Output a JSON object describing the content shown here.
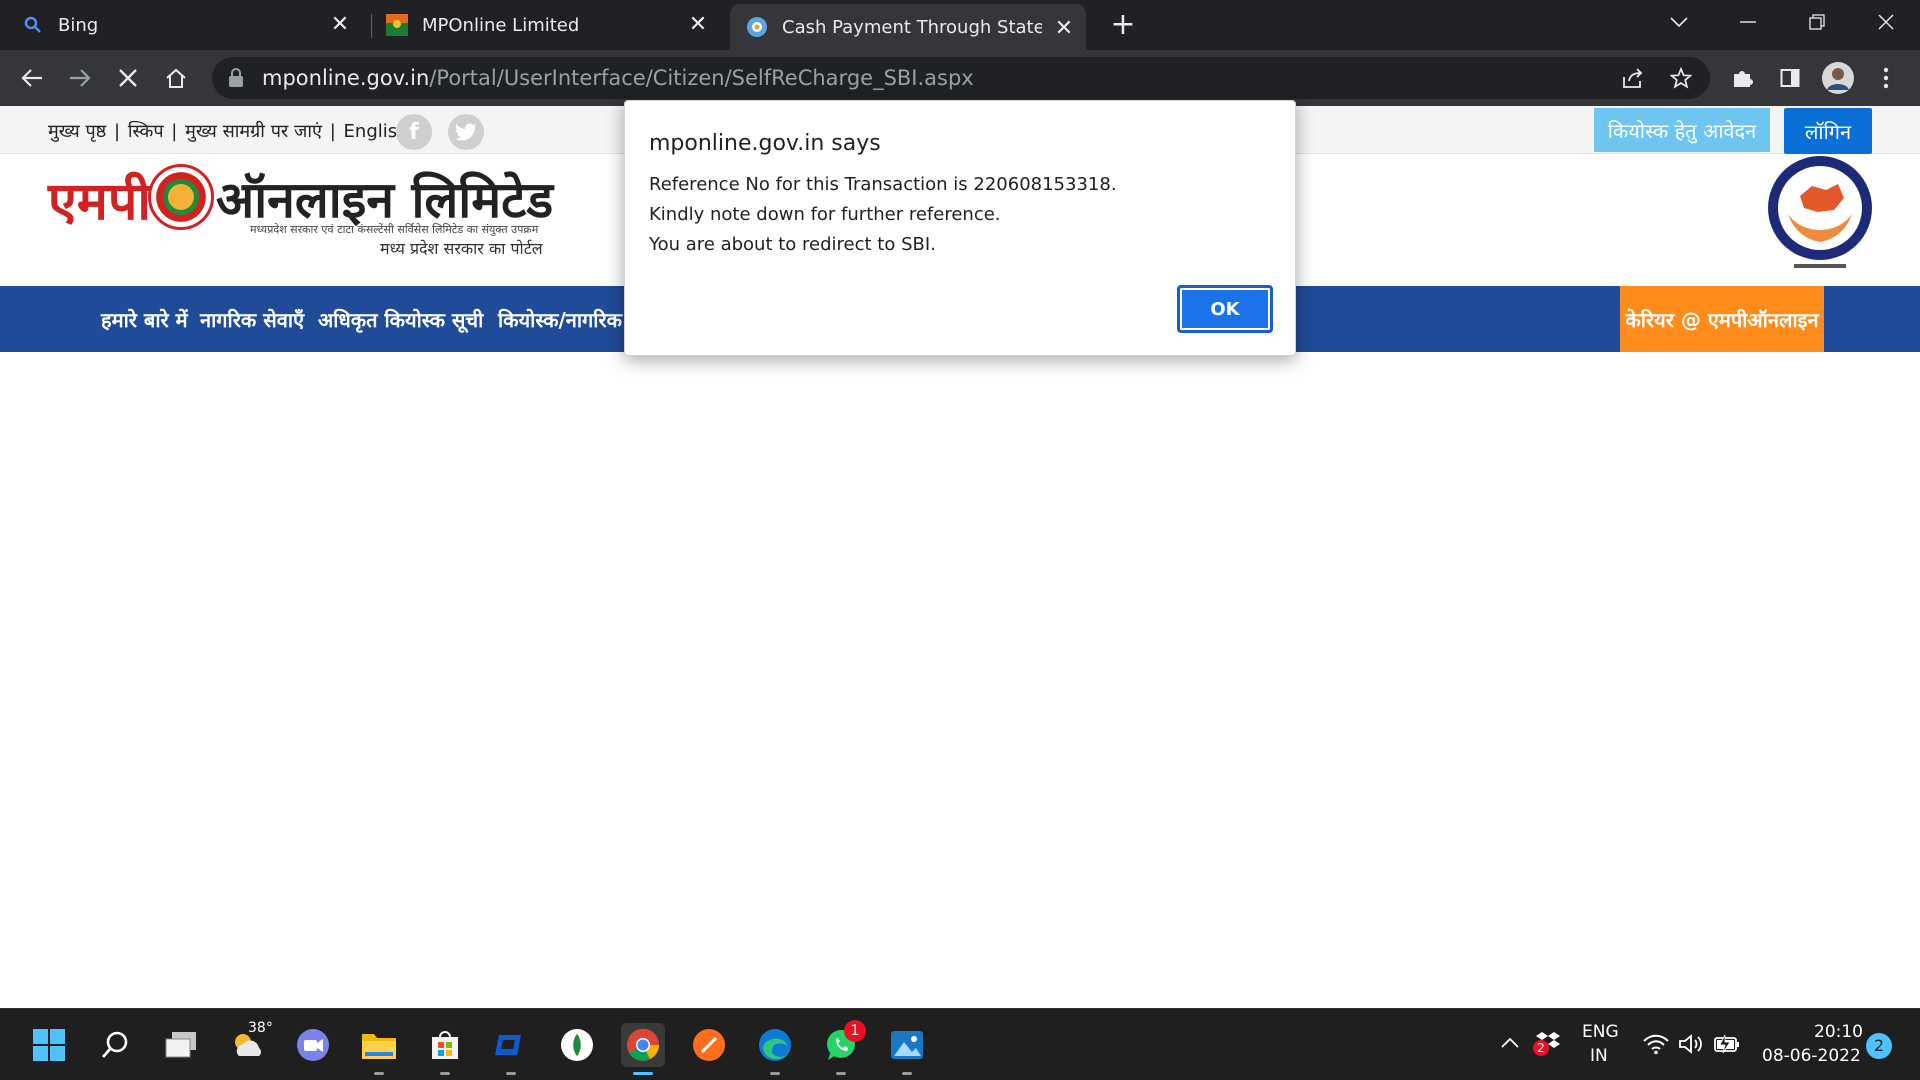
{
  "browser": {
    "tabs": [
      {
        "label": "Bing",
        "icon": "bing-search-icon"
      },
      {
        "label": "MPOnline Limited",
        "icon": "mponline-favicon"
      },
      {
        "label": "Cash Payment Through State Bar",
        "icon": "sbi-favicon",
        "active": true
      }
    ],
    "url_host": "mponline.gov.in",
    "url_path": "/Portal/UserInterface/Citizen/SelfReCharge_SBI.aspx"
  },
  "page": {
    "top_links": [
      "मुख्य पृष्ठ",
      "|",
      "स्किप",
      "|",
      "मुख्य सामग्री पर जाएं",
      "|",
      "English"
    ],
    "kiosk_button": "कियोस्क हेतु आवेदन",
    "login_button": "लॉगिन",
    "logo": {
      "part1": "एमपी",
      "part2": "ऑनलाइन लिमिटेड",
      "tagline": "मध्यप्रदेश सरकार एवं टाटा कंसल्टेंसी सर्विसेस लिमिटेड का संयुक्त उपक्रम",
      "subtitle": "मध्य प्रदेश सरकार का पोर्टल"
    },
    "nav_items": [
      "हमारे बारे में",
      "नागरिक सेवाएँ",
      "अधिकृत कियोस्क सूची",
      "कियोस्क/नागरिक"
    ],
    "career_button": "केरियर @ एमपीऑनलाइन"
  },
  "dialog": {
    "title": "mponline.gov.in says",
    "lines": [
      "Reference No for this Transaction is 220608153318.",
      "Kindly note down for further reference.",
      "You are about to redirect to SBI."
    ],
    "ok_label": "OK"
  },
  "taskbar": {
    "weather_temp": "38°",
    "whatsapp_badge": "1",
    "dropbox_badge": "2",
    "lang_line1": "ENG",
    "lang_line2": "IN",
    "time": "20:10",
    "date": "08-06-2022",
    "notification_count": "2"
  },
  "colors": {
    "nav_blue": "#1f4b99",
    "career_orange": "#ff8c1a",
    "login_blue": "#0a6fd6",
    "kiosk_blue": "#6ec6f0",
    "dialog_ok": "#1a73e8"
  }
}
